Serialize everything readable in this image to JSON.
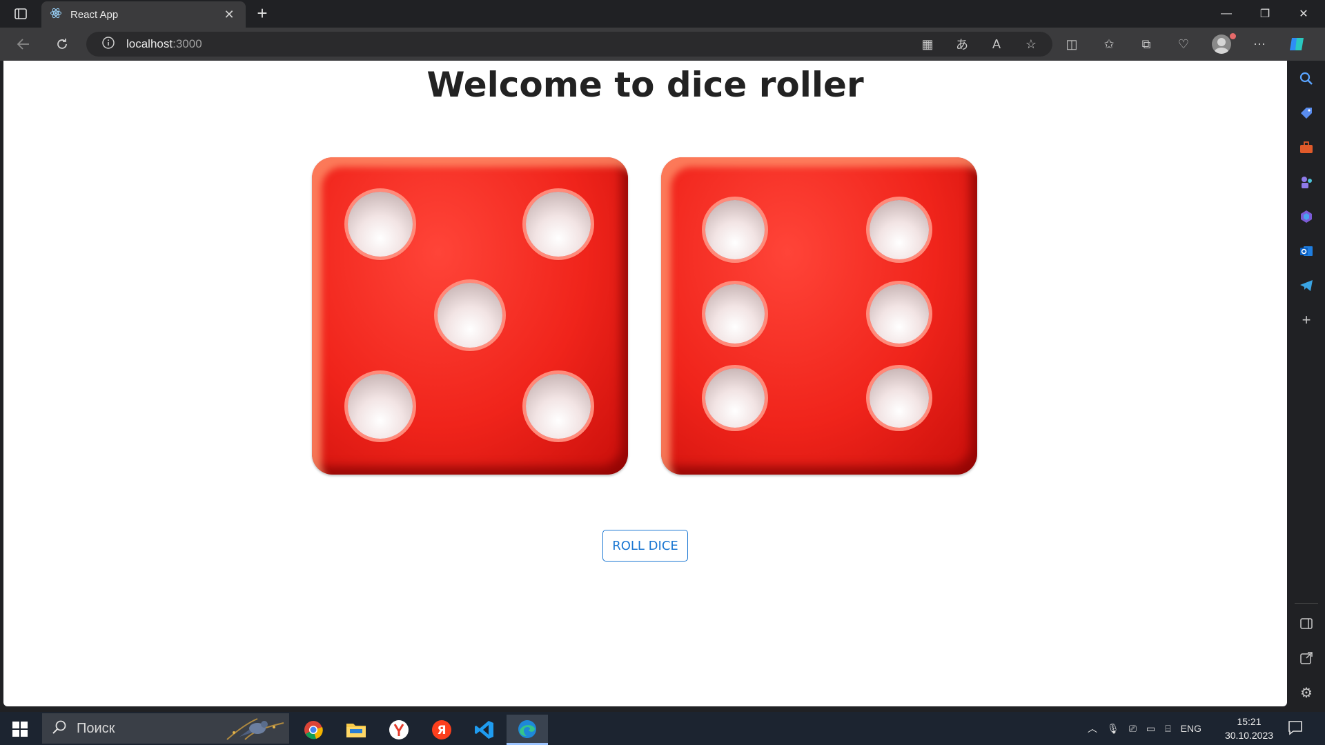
{
  "browser": {
    "tab_title": "React App",
    "address_host": "localhost",
    "address_port": ":3000"
  },
  "page": {
    "title": "Welcome to dice roller",
    "dice": [
      5,
      6
    ],
    "roll_button_label": "ROLL DICE",
    "die_color": "#f0241b",
    "button_color": "#1976d2"
  },
  "taskbar": {
    "search_placeholder": "Поиск",
    "language": "ENG",
    "time": "15:21",
    "date": "30.10.2023",
    "apps": [
      "chrome-icon",
      "file-explorer-icon",
      "yandex-browser-icon",
      "yandex-icon",
      "vscode-icon",
      "edge-icon"
    ]
  },
  "sidebar": {
    "icons": [
      "search-icon",
      "shopping-tag-icon",
      "tools-icon",
      "games-icon",
      "office-icon",
      "outlook-icon",
      "telegram-icon",
      "add-icon"
    ]
  }
}
